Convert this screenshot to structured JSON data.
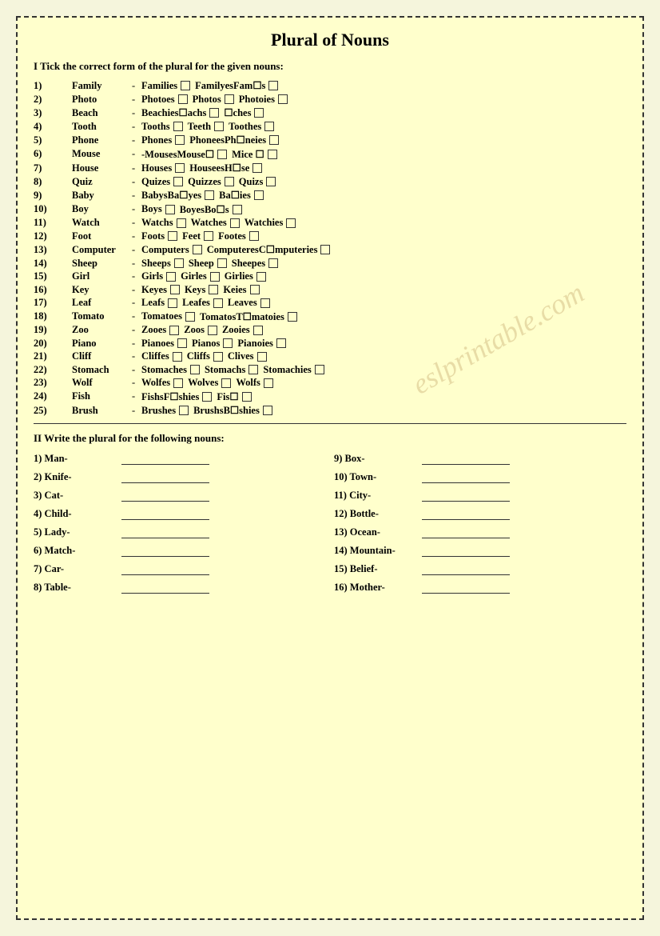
{
  "title": "Plural of Nouns",
  "section1_header": "I Tick the correct form of the plural for the given nouns:",
  "section2_header": "II Write the plural for the following nouns:",
  "rows": [
    {
      "num": "1)",
      "noun": "Family",
      "dash": "-",
      "opts": [
        "Families",
        "FamilyesFam☐s",
        ""
      ]
    },
    {
      "num": "2)",
      "noun": "Photo",
      "dash": "-",
      "opts": [
        "Photoes",
        "Photos",
        "Photoies"
      ]
    },
    {
      "num": "3)",
      "noun": "Beach",
      "dash": "-",
      "opts": [
        "Beachies☐achs",
        "",
        "☐ches"
      ]
    },
    {
      "num": "4)",
      "noun": "Tooth",
      "dash": "-",
      "opts": [
        "Tooths",
        "Teeth",
        "Toothes"
      ]
    },
    {
      "num": "5)",
      "noun": "Phone",
      "dash": "-",
      "opts": [
        "Phones",
        "PhoneesPh☐neies",
        ""
      ]
    },
    {
      "num": "6)",
      "noun": "Mouse",
      "dash": "-",
      "opts": [
        "-MousesMouse☐",
        "Mice ☐",
        ""
      ]
    },
    {
      "num": "7)",
      "noun": "House",
      "dash": "-",
      "opts": [
        "Houses",
        "HouseesH☐se",
        ""
      ]
    },
    {
      "num": "8)",
      "noun": "Quiz",
      "dash": "-",
      "opts": [
        "Quizes",
        "Quizzes",
        "Quizs"
      ]
    },
    {
      "num": "9)",
      "noun": "Baby",
      "dash": "-",
      "opts": [
        "BabysBa☐yes",
        "",
        "Ba☐ies"
      ]
    },
    {
      "num": "10)",
      "noun": "Boy",
      "dash": "-",
      "opts": [
        "Boys",
        "BoyesBo☐s",
        ""
      ]
    },
    {
      "num": "11)",
      "noun": "Watch",
      "dash": "-",
      "opts": [
        "Watchs",
        "Watches",
        "Watchies"
      ]
    },
    {
      "num": "12)",
      "noun": "Foot",
      "dash": "-",
      "opts": [
        "Foots",
        "Feet",
        "Footes"
      ]
    },
    {
      "num": "13)",
      "noun": "Computer",
      "dash": "-",
      "opts": [
        "Computers",
        "ComputeresC☐mputeries",
        ""
      ]
    },
    {
      "num": "14)",
      "noun": "Sheep",
      "dash": "-",
      "opts": [
        "Sheeps",
        "Sheep",
        "Sheepes"
      ]
    },
    {
      "num": "15)",
      "noun": "Girl",
      "dash": "-",
      "opts": [
        "Girls",
        "Girles",
        "Girlies"
      ]
    },
    {
      "num": "16)",
      "noun": "Key",
      "dash": "-",
      "opts": [
        "Keyes",
        "Keys",
        "Keies"
      ]
    },
    {
      "num": "17)",
      "noun": "Leaf",
      "dash": "-",
      "opts": [
        "Leafs",
        "Leafes",
        "Leaves"
      ]
    },
    {
      "num": "18)",
      "noun": "Tomato",
      "dash": "-",
      "opts": [
        "Tomatoes",
        "TomatosT☐matoies",
        ""
      ]
    },
    {
      "num": "19)",
      "noun": "Zoo",
      "dash": "-",
      "opts": [
        "Zooes",
        "Zoos",
        "Zooies"
      ]
    },
    {
      "num": "20)",
      "noun": "Piano",
      "dash": "-",
      "opts": [
        "Pianoes",
        "Pianos",
        "Pianoies"
      ]
    },
    {
      "num": "21)",
      "noun": "Cliff",
      "dash": "-",
      "opts": [
        "Cliffes",
        "Cliffs",
        "Clives"
      ]
    },
    {
      "num": "22)",
      "noun": "Stomach",
      "dash": "-",
      "opts": [
        "Stomaches",
        "Stomachs",
        "Stomachies"
      ]
    },
    {
      "num": "23)",
      "noun": "Wolf",
      "dash": "-",
      "opts": [
        "Wolfes",
        "Wolves",
        "Wolfs"
      ]
    },
    {
      "num": "24)",
      "noun": "Fish",
      "dash": "-",
      "opts": [
        "FishsF☐shies",
        "",
        "Fis☐"
      ]
    },
    {
      "num": "25)",
      "noun": "Brush",
      "dash": "-",
      "opts": [
        "Brushes",
        "",
        "BrushsB☐shies"
      ]
    }
  ],
  "write_left": [
    {
      "num": "1)",
      "label": "Man-"
    },
    {
      "num": "2)",
      "label": "Knife-"
    },
    {
      "num": "3)",
      "label": "Cat-"
    },
    {
      "num": "4)",
      "label": "Child-"
    },
    {
      "num": "5)",
      "label": "Lady-"
    },
    {
      "num": "6)",
      "label": "Match-"
    },
    {
      "num": "7)",
      "label": "Car-"
    },
    {
      "num": "8)",
      "label": "Table-"
    }
  ],
  "write_right": [
    {
      "num": "9)",
      "label": "Box-"
    },
    {
      "num": "10)",
      "label": "Town-"
    },
    {
      "num": "11)",
      "label": "City-"
    },
    {
      "num": "12)",
      "label": "Bottle-"
    },
    {
      "num": "13)",
      "label": "Ocean-"
    },
    {
      "num": "14)",
      "label": "Mountain-"
    },
    {
      "num": "15)",
      "label": "Belief-"
    },
    {
      "num": "16)",
      "label": "Mother-"
    }
  ]
}
